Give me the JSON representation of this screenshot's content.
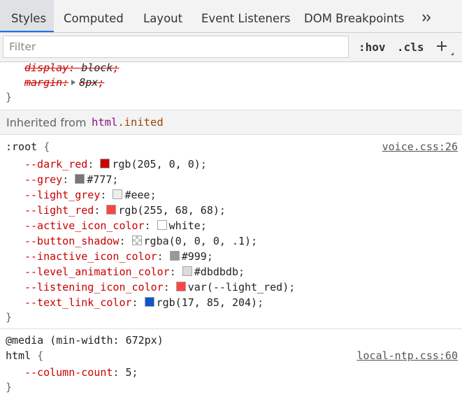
{
  "tabs": [
    {
      "label": "Styles",
      "active": true
    },
    {
      "label": "Computed"
    },
    {
      "label": "Layout"
    },
    {
      "label": "Event Listeners"
    },
    {
      "label": "DOM Breakpoints"
    }
  ],
  "tab_more_icon": "double-chevron-right-icon",
  "toolbar": {
    "filter_placeholder": "Filter",
    "hov_label": ":hov",
    "cls_label": ".cls",
    "plus_icon": "plus-icon"
  },
  "rule0": {
    "props": [
      {
        "name": "display",
        "value": "block"
      },
      {
        "name": "margin",
        "value": "8px"
      }
    ],
    "close_brace": "}"
  },
  "inherited": {
    "label": "Inherited from",
    "tag": "html",
    "class": ".inited"
  },
  "rule_root": {
    "selector": ":root",
    "open_brace": "{",
    "source": "voice.css:26",
    "close_brace": "}",
    "props": [
      {
        "name": "--dark_red",
        "value": "rgb(205, 0, 0)",
        "swatch": "#cd0000"
      },
      {
        "name": "--grey",
        "value": "#777",
        "swatch": "#777777"
      },
      {
        "name": "--light_grey",
        "value": "#eee",
        "swatch": "#eeeeee"
      },
      {
        "name": "--light_red",
        "value": "rgb(255, 68, 68)",
        "swatch": "#ff4444"
      },
      {
        "name": "--active_icon_color",
        "value": "white",
        "swatch": "#ffffff"
      },
      {
        "name": "--button_shadow",
        "value": "rgba(0, 0, 0, .1)",
        "swatch": "checker"
      },
      {
        "name": "--inactive_icon_color",
        "value": "#999",
        "swatch": "#999999"
      },
      {
        "name": "--level_animation_color",
        "value": "#dbdbdb",
        "swatch": "#dbdbdb"
      },
      {
        "name": "--listening_icon_color",
        "value": "var(--light_red)",
        "swatch": "#ff4444"
      },
      {
        "name": "--text_link_color",
        "value": "rgb(17, 85, 204)",
        "swatch": "#1155cc"
      }
    ]
  },
  "rule_media": {
    "media": "@media (min-width: 672px)",
    "selector": "html",
    "open_brace": "{",
    "source": "local-ntp.css:60",
    "close_brace": "}",
    "props": [
      {
        "name": "--column-count",
        "value": "5"
      }
    ]
  },
  "colors": {
    "accent": "#1a73e8",
    "property_name": "#c80000",
    "tag": "#881280",
    "class": "#994500"
  }
}
